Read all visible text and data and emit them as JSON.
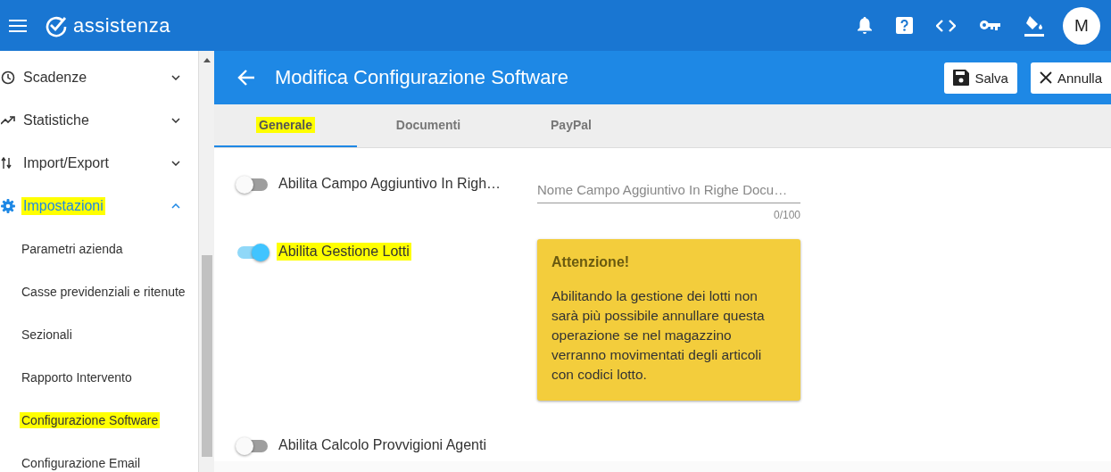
{
  "app_bar": {
    "brand": "assistenza",
    "actions": [
      {
        "kind": "bell"
      },
      {
        "kind": "help"
      },
      {
        "kind": "code"
      },
      {
        "kind": "key"
      },
      {
        "kind": "paint"
      }
    ],
    "avatar": "M"
  },
  "sidebar": {
    "items": [
      {
        "label": "Scadenze",
        "kind": "clock",
        "selected": false,
        "expanded": false,
        "highlighted": false
      },
      {
        "label": "Statistiche",
        "kind": "trend",
        "selected": false,
        "expanded": false,
        "highlighted": false
      },
      {
        "label": "Import/Export",
        "kind": "swap",
        "selected": false,
        "expanded": false,
        "highlighted": false
      },
      {
        "label": "Impostazioni",
        "kind": "gear",
        "selected": true,
        "expanded": true,
        "highlighted": true,
        "children": [
          {
            "label": "Parametri azienda",
            "highlighted": false
          },
          {
            "label": "Casse previdenziali e ritenute",
            "highlighted": false
          },
          {
            "label": "Sezionali",
            "highlighted": false
          },
          {
            "label": "Rapporto Intervento",
            "highlighted": false
          },
          {
            "label": "Configurazione Software",
            "highlighted": true
          },
          {
            "label": "Configurazione Email",
            "highlighted": false
          }
        ]
      }
    ]
  },
  "page_header": {
    "title": "Modifica Configurazione Software",
    "buttons": [
      {
        "label": "Salva",
        "kind": "save"
      },
      {
        "label": "Annulla",
        "kind": "cancel"
      }
    ]
  },
  "tabs": [
    {
      "label": "Generale",
      "selected": true,
      "highlighted": true
    },
    {
      "label": "Documenti",
      "selected": false,
      "highlighted": false
    },
    {
      "label": "PayPal",
      "selected": false,
      "highlighted": false
    }
  ],
  "form": {
    "toggles": [
      {
        "label": "Abilita Campo Aggiuntivo In Righ…",
        "on": false,
        "highlighted": false
      },
      {
        "label": "Abilita Gestione Lotti",
        "on": true,
        "highlighted": true
      },
      {
        "label": "Abilita Calcolo Provvigioni Agenti",
        "on": false,
        "highlighted": false
      }
    ],
    "field": {
      "placeholder": "Nome Campo Aggiuntivo In Righe Docu…",
      "counter": "0/100"
    },
    "alert": {
      "title": "Attenzione!",
      "text": "Abilitando la gestione dei lotti non sarà più possibile annullare questa operazione se nel magazzino verranno movimentati degli articoli con codici lotto."
    }
  }
}
